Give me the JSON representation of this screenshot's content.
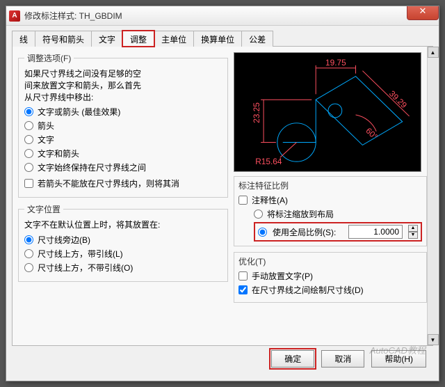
{
  "window": {
    "title": "修改标注样式: TH_GBDIM",
    "icon_letter": "A"
  },
  "tabs": [
    "线",
    "符号和箭头",
    "文字",
    "调整",
    "主单位",
    "换算单位",
    "公差"
  ],
  "active_tab": 3,
  "fit": {
    "legend": "调整选项(F)",
    "desc1": "如果尺寸界线之间没有足够的空",
    "desc2": "间来放置文字和箭头，那么首先",
    "desc3": "从尺寸界线中移出:",
    "opt1": "文字或箭头 (最佳效果)",
    "opt2": "箭头",
    "opt3": "文字",
    "opt4": "文字和箭头",
    "opt5": "文字始终保持在尺寸界线之间",
    "chk1": "若箭头不能放在尺寸界线内，则将其消"
  },
  "textpos": {
    "legend": "文字位置",
    "desc": "文字不在默认位置上时，将其放置在:",
    "opt1": "尺寸线旁边(B)",
    "opt2": "尺寸线上方，带引线(L)",
    "opt3": "尺寸线上方，不带引线(O)"
  },
  "scale": {
    "legend": "标注特征比例",
    "chk_annot": "注释性(A)",
    "opt_layout": "将标注缩放到布局",
    "opt_global": "使用全局比例(S):",
    "value": "1.0000"
  },
  "tune": {
    "legend": "优化(T)",
    "chk1": "手动放置文字(P)",
    "chk2": "在尺寸界线之间绘制尺寸线(D)"
  },
  "chart_data": {
    "type": "preview-drawing",
    "dims": [
      {
        "label": "19.75",
        "orientation": "horizontal"
      },
      {
        "label": "23.25",
        "orientation": "vertical"
      },
      {
        "label": "39.29",
        "orientation": "aligned"
      },
      {
        "label": "60°",
        "orientation": "angular"
      },
      {
        "label": "R15.64",
        "orientation": "radius"
      }
    ]
  },
  "buttons": {
    "ok": "确定",
    "cancel": "取消",
    "help": "帮助(H)"
  },
  "watermark": "AutoCAD教程"
}
